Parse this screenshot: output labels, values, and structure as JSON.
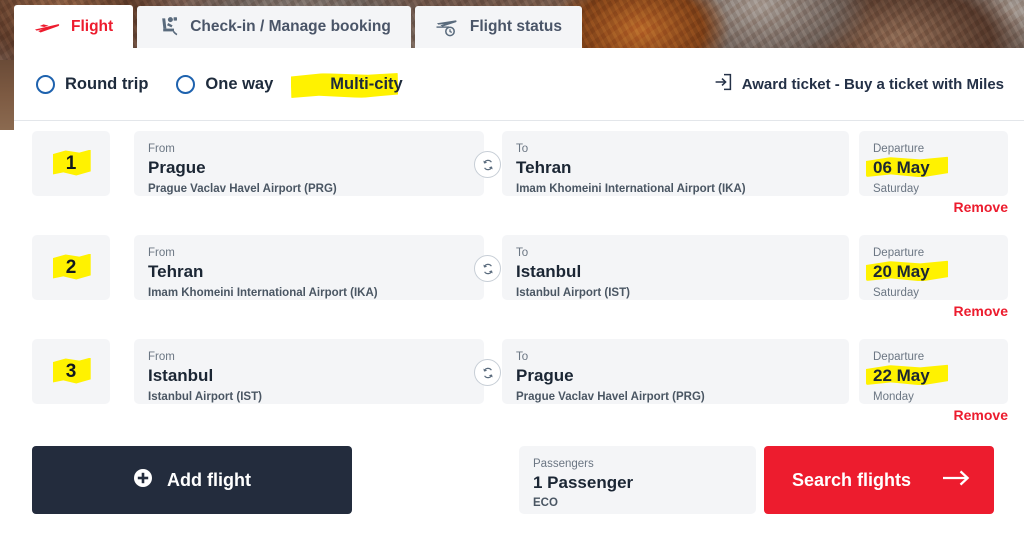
{
  "tabs": [
    {
      "label": "Flight",
      "icon": "airplane-icon",
      "active": true
    },
    {
      "label": "Check-in / Manage booking",
      "icon": "seat-passenger-icon",
      "active": false
    },
    {
      "label": "Flight status",
      "icon": "airplane-clock-icon",
      "active": false
    }
  ],
  "trip_type": {
    "options": [
      {
        "label": "Round trip",
        "selected": false,
        "highlighted": false
      },
      {
        "label": "One way",
        "selected": false,
        "highlighted": false
      },
      {
        "label": "Multi-city",
        "selected": true,
        "highlighted": true
      }
    ]
  },
  "award": {
    "icon": "login-arrow-icon",
    "label": "Award ticket - Buy a ticket with Miles"
  },
  "labels": {
    "from": "From",
    "to": "To",
    "departure": "Departure",
    "remove": "Remove",
    "swap_icon": "swap-arrows-icon"
  },
  "flights": [
    {
      "index": "1",
      "from_city": "Prague",
      "from_airport": "Prague Vaclav Havel Airport (PRG)",
      "to_city": "Tehran",
      "to_airport": "Imam Khomeini International Airport (IKA)",
      "date": "06 May",
      "weekday": "Saturday",
      "remove": "Remove"
    },
    {
      "index": "2",
      "from_city": "Tehran",
      "from_airport": "Imam Khomeini International Airport (IKA)",
      "to_city": "Istanbul",
      "to_airport": "Istanbul Airport (IST)",
      "date": "20 May",
      "weekday": "Saturday",
      "remove": "Remove"
    },
    {
      "index": "3",
      "from_city": "Istanbul",
      "from_airport": "Istanbul Airport (IST)",
      "to_city": "Prague",
      "to_airport": "Prague Vaclav Havel Airport (PRG)",
      "date": "22 May",
      "weekday": "Monday",
      "remove": "Remove"
    }
  ],
  "actions": {
    "add_flight": "Add flight",
    "add_flight_icon": "plus-circle-icon",
    "passengers_label": "Passengers",
    "passengers_value": "1 Passenger",
    "cabin_class": "ECO",
    "search_label": "Search flights",
    "search_icon": "arrow-right-icon"
  },
  "colors": {
    "brand_red": "#ed1c2e",
    "dark_navy": "#232c3d",
    "highlight_yellow": "#fff200",
    "radio_blue": "#1e62ae",
    "radio_selected_green": "#0e6a3f",
    "field_bg": "#f4f5f7"
  }
}
